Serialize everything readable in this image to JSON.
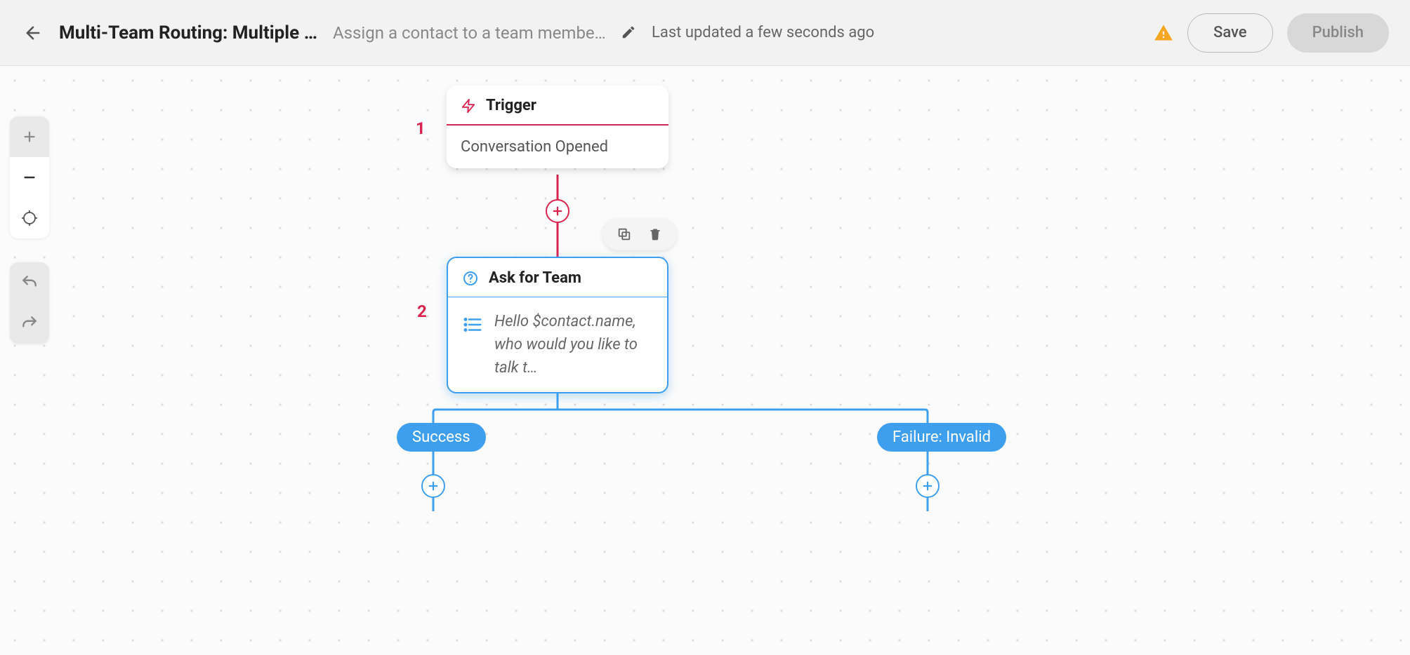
{
  "header": {
    "title": "Multi-Team Routing: Multiple Choic…",
    "subtitle": "Assign a contact to a team member bas…",
    "last_updated": "Last updated a few seconds ago",
    "save_label": "Save",
    "publish_label": "Publish"
  },
  "nodes": {
    "trigger": {
      "number": "1",
      "title": "Trigger",
      "body": "Conversation Opened"
    },
    "ask_team": {
      "number": "2",
      "title": "Ask for Team",
      "message": "Hello $contact.name, who would you like to talk t…"
    }
  },
  "branches": {
    "success": "Success",
    "failure": "Failure: Invalid"
  }
}
